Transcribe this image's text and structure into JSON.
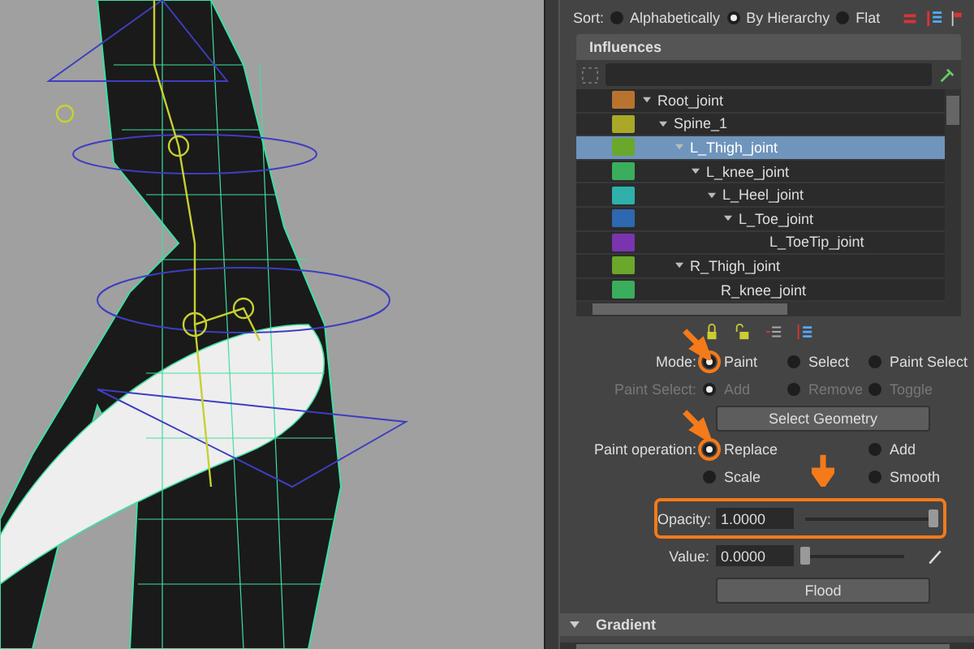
{
  "sort": {
    "label": "Sort:",
    "options": [
      {
        "label": "Alphabetically",
        "selected": false
      },
      {
        "label": "By Hierarchy",
        "selected": true
      },
      {
        "label": "Flat",
        "selected": false
      }
    ]
  },
  "influences": {
    "title": "Influences",
    "items": [
      {
        "name": "Root_joint",
        "color": "#b8732f",
        "selected": false,
        "children": [
          {
            "name": "Spine_1",
            "color": "#a9a828",
            "selected": false,
            "children": [
              {
                "name": "L_Thigh_joint",
                "color": "#6aa72b",
                "selected": true,
                "children": [
                  {
                    "name": "L_knee_joint",
                    "color": "#3aae5c",
                    "selected": false,
                    "children": [
                      {
                        "name": "L_Heel_joint",
                        "color": "#2fb0aa",
                        "selected": false,
                        "children": [
                          {
                            "name": "L_Toe_joint",
                            "color": "#2e68b0",
                            "selected": false,
                            "children": [
                              {
                                "name": "L_ToeTip_joint",
                                "color": "#7a34b0",
                                "selected": false
                              }
                            ]
                          }
                        ]
                      }
                    ]
                  }
                ]
              },
              {
                "name": "R_Thigh_joint",
                "color": "#6aa72b",
                "selected": false,
                "children": [
                  {
                    "name": "R_knee_joint",
                    "color": "#3aae5c",
                    "selected": false
                  }
                ]
              }
            ]
          }
        ]
      }
    ]
  },
  "mode": {
    "label": "Mode:",
    "options": [
      {
        "label": "Paint",
        "selected": true
      },
      {
        "label": "Select",
        "selected": false
      },
      {
        "label": "Paint Select",
        "selected": false
      }
    ]
  },
  "paint_select": {
    "label": "Paint Select:",
    "disabled": true,
    "options": [
      {
        "label": "Add",
        "selected": true
      },
      {
        "label": "Remove",
        "selected": false
      },
      {
        "label": "Toggle",
        "selected": false
      }
    ]
  },
  "select_geometry_button": "Select Geometry",
  "paint_operation": {
    "label": "Paint operation:",
    "options": [
      {
        "label": "Replace",
        "selected": true
      },
      {
        "label": "Add",
        "selected": false
      },
      {
        "label": "Scale",
        "selected": false
      },
      {
        "label": "Smooth",
        "selected": false
      }
    ]
  },
  "opacity": {
    "label": "Opacity:",
    "value": "1.0000",
    "level": 1
  },
  "value": {
    "label": "Value:",
    "value": "0.0000",
    "level": 0
  },
  "flood_button": "Flood",
  "gradient": {
    "title": "Gradient",
    "expanded": true
  }
}
